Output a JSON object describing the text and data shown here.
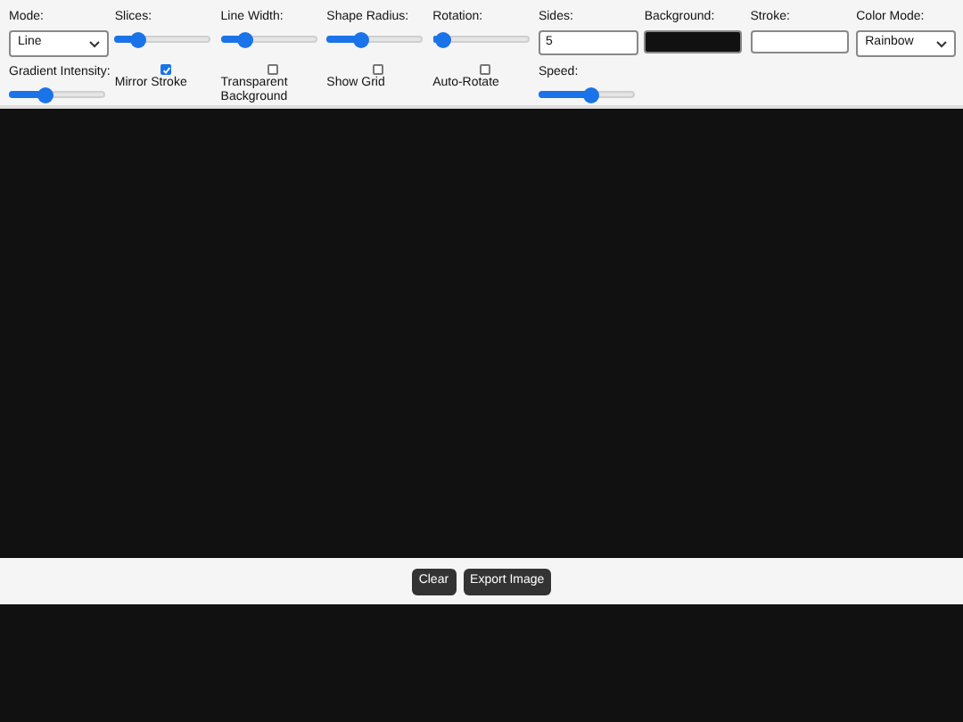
{
  "controls": [
    {
      "kind": "select",
      "label": "Mode:",
      "value": "Line"
    },
    {
      "kind": "slider",
      "label": "Slices:",
      "level": 0.2
    },
    {
      "kind": "slider",
      "label": "Line Width:",
      "level": 0.2
    },
    {
      "kind": "slider",
      "label": "Shape Radius:",
      "level": 0.32
    },
    {
      "kind": "slider",
      "label": "Rotation:",
      "level": 0.04
    },
    {
      "kind": "number",
      "label": "Sides:",
      "value": "5"
    },
    {
      "kind": "color",
      "label": "Background:",
      "color": "#111111"
    },
    {
      "kind": "color",
      "label": "Stroke:",
      "color": "#ffffff"
    },
    {
      "kind": "select",
      "label": "Color Mode:",
      "value": "Rainbow"
    },
    {
      "kind": "slider",
      "label": "Gradient Intensity:",
      "level": 0.36
    },
    {
      "kind": "checkbox",
      "label": "Mirror Stroke",
      "checked": true
    },
    {
      "kind": "checkbox",
      "label": "Transparent Background",
      "checked": false
    },
    {
      "kind": "checkbox",
      "label": "Show Grid",
      "checked": false
    },
    {
      "kind": "checkbox",
      "label": "Auto-Rotate",
      "checked": false
    },
    {
      "kind": "slider",
      "label": "Speed:",
      "level": 0.55
    }
  ],
  "buttons": [
    "Clear",
    "Export Image"
  ]
}
